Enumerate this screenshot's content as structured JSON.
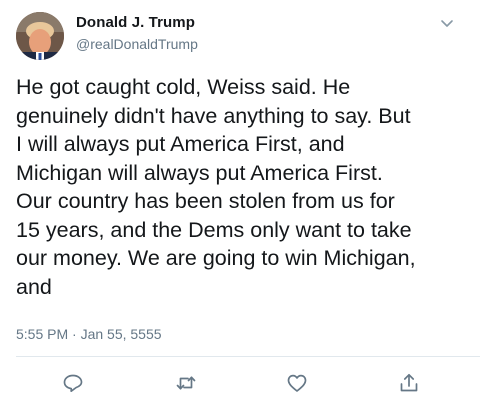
{
  "author": {
    "display_name": "Donald J. Trump",
    "handle": "@realDonaldTrump"
  },
  "tweet": {
    "text": "He got caught cold, Weiss said. He\ngenuinely didn't have anything to say. But\nI will always put America First, and\nMichigan will always put America First.\nOur country has been stolen from us for\n15 years, and the Dems only want to take\nour money. We are going to win Michigan,\nand",
    "timestamp": "5:55 PM · Jan 55, 5555"
  },
  "icons": {
    "menu": "chevron-down-icon",
    "reply": "reply-icon",
    "retweet": "retweet-icon",
    "like": "heart-icon",
    "share": "share-icon"
  },
  "colors": {
    "text": "#14171a",
    "secondary": "#657786",
    "divider": "#e1e8ed"
  }
}
